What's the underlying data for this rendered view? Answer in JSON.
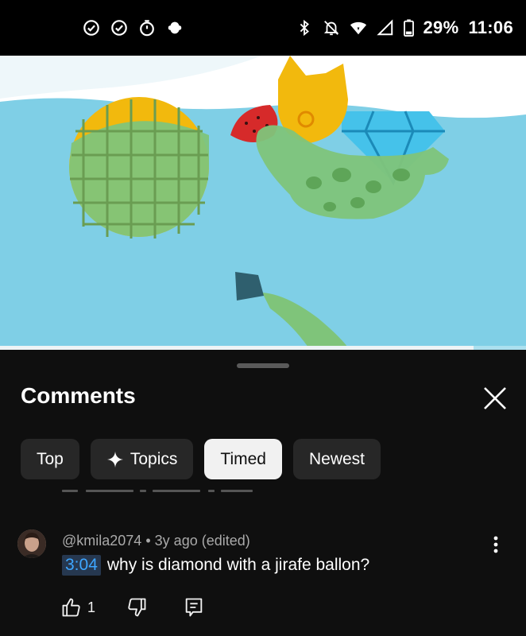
{
  "status_bar": {
    "left_icons": [
      "check-circle-icon",
      "check-circle-icon",
      "timer-icon",
      "bug-icon"
    ],
    "right_icons": [
      "bluetooth-icon",
      "notifications-off-icon",
      "wifi-icon",
      "signal-icon",
      "battery-icon"
    ],
    "battery": "29%",
    "time": "11:06"
  },
  "video": {
    "progress_fraction": 0.9,
    "colors": {
      "water": "#7fcfe6",
      "waffle": "#f2b90d",
      "giraffe_float": "#7fc47a",
      "diamond": "#45c2ea",
      "strawberry": "#d62a2a"
    }
  },
  "comments_sheet": {
    "title": "Comments",
    "filters": [
      {
        "label": "Top",
        "selected": false
      },
      {
        "label": "Topics",
        "selected": false,
        "icon": "sparkle-icon"
      },
      {
        "label": "Timed",
        "selected": true
      },
      {
        "label": "Newest",
        "selected": false
      }
    ],
    "comment": {
      "author": "@kmila2074",
      "age": "3y ago",
      "edited": "(edited)",
      "separator": "•",
      "timestamp": "3:04",
      "text": "why is diamond with a jirafe ballon?",
      "likes": "1"
    }
  }
}
